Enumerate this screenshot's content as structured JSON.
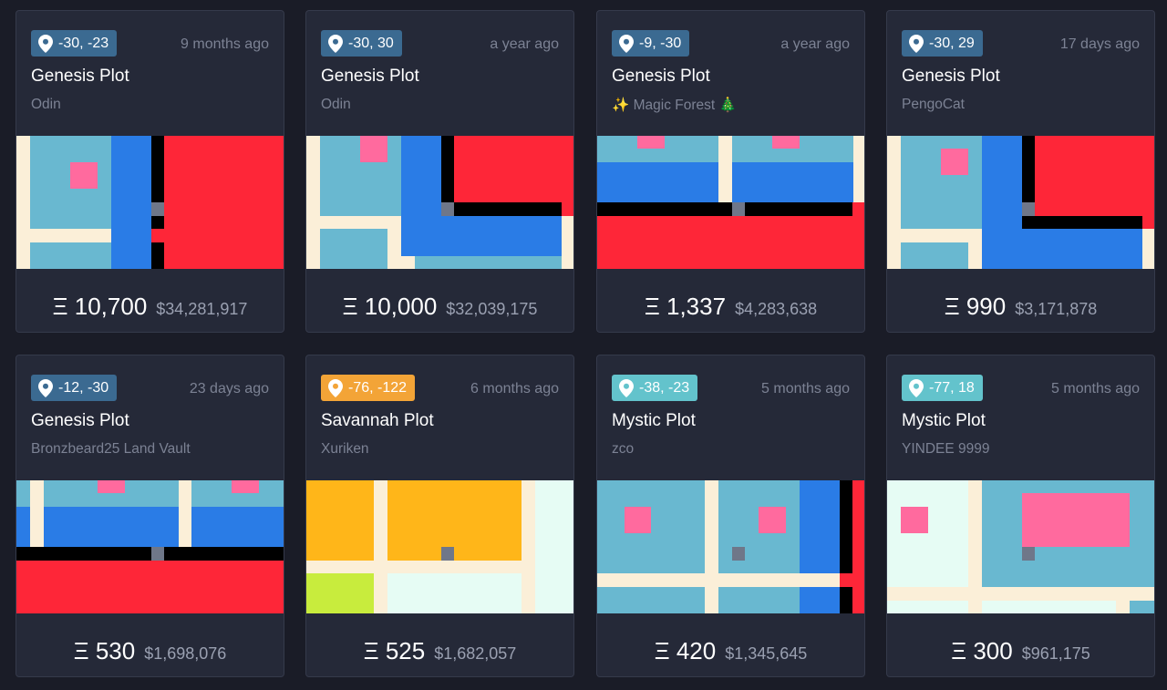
{
  "colors": {
    "page_bg": "#1a1c27",
    "card_bg": "#252938",
    "card_border": "#353a4b",
    "badge_genesis": "#3b6a91",
    "badge_savannah": "#f3a437",
    "badge_mystic": "#63c3cc",
    "muted_text": "#7c8294",
    "tile_water": "#69b8d0",
    "tile_road": "#fbefd8",
    "tile_blue": "#2a7ce6",
    "tile_red": "#fe2638",
    "tile_pink": "#ff6a9e",
    "tile_black": "#000000",
    "tile_gray": "#6f7789",
    "tile_yellow": "#ffb619",
    "tile_lime": "#c8ec3d",
    "tile_mint": "#e6fcf4"
  },
  "currency_symbol": "Ξ",
  "listings": [
    {
      "coords": "-30, -23",
      "age": "9 months ago",
      "plot_type": "Genesis Plot",
      "owner": "Odin",
      "price_eth": "10,700",
      "price_usd": "$34,281,917",
      "badge_icon": "map-pin-icon"
    },
    {
      "coords": "-30, 30",
      "age": "a year ago",
      "plot_type": "Genesis Plot",
      "owner": "Odin",
      "price_eth": "10,000",
      "price_usd": "$32,039,175",
      "badge_icon": "map-pin-icon"
    },
    {
      "coords": "-9, -30",
      "age": "a year ago",
      "plot_type": "Genesis Plot",
      "owner": "✨ Magic Forest 🎄",
      "price_eth": "1,337",
      "price_usd": "$4,283,638",
      "badge_icon": "map-pin-icon"
    },
    {
      "coords": "-30, 29",
      "age": "17 days ago",
      "plot_type": "Genesis Plot",
      "owner": "PengoCat",
      "price_eth": "990",
      "price_usd": "$3,171,878",
      "badge_icon": "map-pin-icon"
    },
    {
      "coords": "-12, -30",
      "age": "23 days ago",
      "plot_type": "Genesis Plot",
      "owner": "Bronzbeard25 Land Vault",
      "price_eth": "530",
      "price_usd": "$1,698,076",
      "badge_icon": "map-pin-icon"
    },
    {
      "coords": "-76, -122",
      "age": "6 months ago",
      "plot_type": "Savannah Plot",
      "owner": "Xuriken",
      "price_eth": "525",
      "price_usd": "$1,682,057",
      "badge_icon": "map-pin-icon"
    },
    {
      "coords": "-38, -23",
      "age": "5 months ago",
      "plot_type": "Mystic Plot",
      "owner": "zco",
      "price_eth": "420",
      "price_usd": "$1,345,645",
      "badge_icon": "map-pin-icon"
    },
    {
      "coords": "-77, 18",
      "age": "5 months ago",
      "plot_type": "Mystic Plot",
      "owner": "YINDEE 9999",
      "price_eth": "300",
      "price_usd": "$961,175",
      "badge_icon": "map-pin-icon"
    }
  ]
}
